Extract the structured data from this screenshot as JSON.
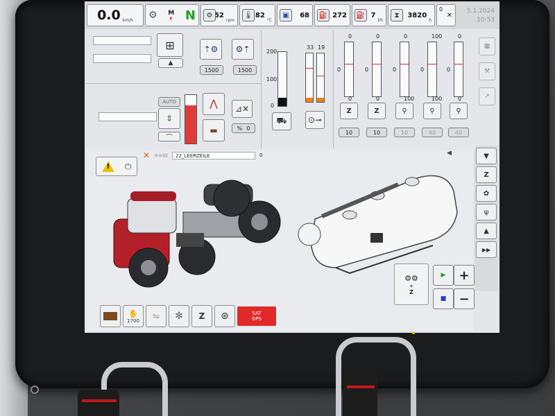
{
  "status": {
    "speed": "0.0",
    "speed_unit": "km/h",
    "mode_letter": "M",
    "mode_sub": "F",
    "gear": "N",
    "rpm": "852",
    "rpm_unit": "rpm",
    "temp": "82",
    "temp_unit": "°C",
    "fuel_pct": "68",
    "fuel_level": "272",
    "fuel_rate": "7",
    "fuel_rate_unit": "l/h",
    "hours": "3820",
    "hours_unit": "h",
    "counter": "0",
    "date": "5.1.2024",
    "time": "10:53"
  },
  "hitch": {
    "front_value": "1500",
    "rear_value": "1500",
    "auto_label": "AUTO",
    "percent_value": "0"
  },
  "gauge_main": {
    "ticks": [
      "200",
      "100",
      "0"
    ],
    "fill": 0.15
  },
  "gauge_pair": {
    "left": "33",
    "right": "19"
  },
  "valves": [
    {
      "top": "0",
      "mid": "0",
      "bottom": "0",
      "value": "10"
    },
    {
      "top": "0",
      "mid": "0",
      "bottom": "0",
      "value": "10"
    },
    {
      "top": "0",
      "mid": "0",
      "bottom": "100",
      "value": "10"
    },
    {
      "top": "100",
      "mid": "0",
      "bottom": "100",
      "value": "40"
    },
    {
      "top": "0",
      "mid": "0",
      "bottom": "0",
      "value": "40"
    }
  ],
  "file_bar": {
    "name": "22_LEERZEILE",
    "count": "0"
  },
  "bottom": {
    "hour_value": "1700",
    "sat_label": "SAT",
    "gps_label": "GPS"
  },
  "colors": {
    "accent_red": "#c8202a",
    "gear_green": "#20a020",
    "warning_yellow": "#e8c300"
  }
}
